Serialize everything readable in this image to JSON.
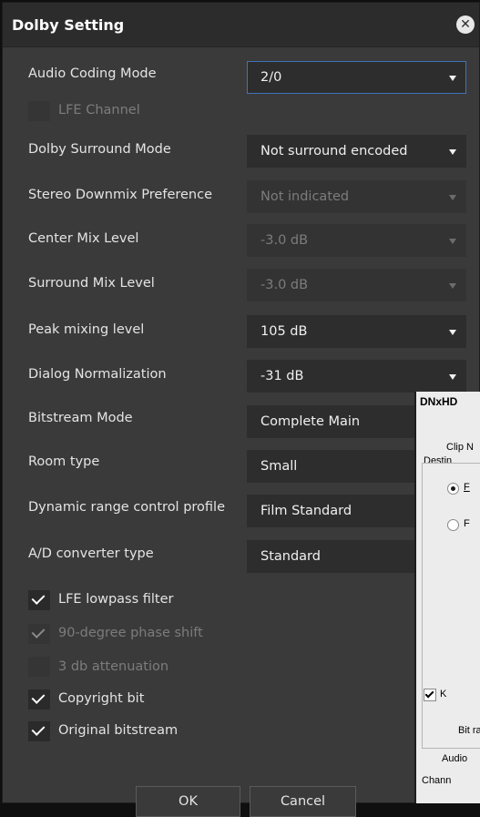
{
  "dialog": {
    "title": "Dolby Setting",
    "close_icon": "close-icon",
    "rows": {
      "audio_coding_mode": {
        "label": "Audio Coding Mode",
        "value": "2/0"
      },
      "dolby_surround_mode": {
        "label": "Dolby Surround Mode",
        "value": "Not surround encoded"
      },
      "stereo_downmix": {
        "label": "Stereo Downmix Preference",
        "value": "Not indicated"
      },
      "center_mix": {
        "label": "Center Mix Level",
        "value": "-3.0 dB"
      },
      "surround_mix": {
        "label": "Surround Mix Level",
        "value": "-3.0 dB"
      },
      "peak_mixing": {
        "label": "Peak mixing level",
        "value": "105 dB"
      },
      "dialog_norm": {
        "label": "Dialog Normalization",
        "value": "-31 dB"
      },
      "bitstream_mode": {
        "label": "Bitstream Mode",
        "value": "Complete Main"
      },
      "room_type": {
        "label": "Room type",
        "value": "Small"
      },
      "drc_profile": {
        "label": "Dynamic range control profile",
        "value": "Film Standard"
      },
      "ad_converter": {
        "label": "A/D converter type",
        "value": "Standard"
      }
    },
    "checks": {
      "lfe_channel": {
        "label": "LFE Channel",
        "checked": false,
        "enabled": false
      },
      "lfe_lowpass": {
        "label": "LFE lowpass filter",
        "checked": true,
        "enabled": true
      },
      "phase_shift": {
        "label": "90-degree phase shift",
        "checked": true,
        "enabled": false
      },
      "attenuation": {
        "label": "3 db attenuation",
        "checked": false,
        "enabled": false
      },
      "copyright": {
        "label": "Copyright bit",
        "checked": true,
        "enabled": true
      },
      "original": {
        "label": "Original bitstream",
        "checked": true,
        "enabled": true
      }
    },
    "buttons": {
      "ok": "OK",
      "cancel": "Cancel"
    }
  },
  "background_window": {
    "title": "DNxHD",
    "clip": "Clip N",
    "destination": "Destin",
    "radio1": "F",
    "radio2": "F",
    "check_label": "K",
    "bitrate": "Bit ra",
    "audio": "Audio",
    "channels": "Chann"
  }
}
